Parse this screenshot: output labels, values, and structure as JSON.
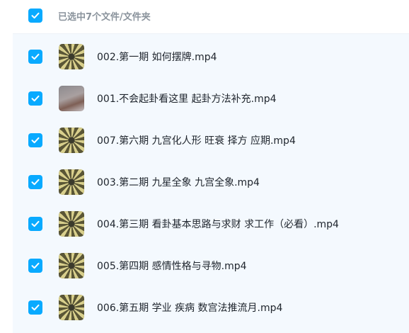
{
  "header": {
    "selection_label": "已选中7个文件/文件夹",
    "checked": true
  },
  "files": [
    {
      "name": "002.第一期 如何摆牌.mp4",
      "thumbnail": "bagua-thumbnail",
      "checked": true
    },
    {
      "name": "001.不会起卦看这里 起卦方法补充.mp4",
      "thumbnail": "photo-thumbnail",
      "checked": true
    },
    {
      "name": "007.第六期 九宫化人形 旺衰 择方 应期.mp4",
      "thumbnail": "bagua-thumbnail",
      "checked": true
    },
    {
      "name": "003.第二期 九星全象 九宫全象.mp4",
      "thumbnail": "bagua-thumbnail",
      "checked": true
    },
    {
      "name": "004.第三期 看卦基本思路与求财 求工作（必看）.mp4",
      "thumbnail": "bagua-thumbnail",
      "checked": true
    },
    {
      "name": "005.第四期 感情性格与寻物.mp4",
      "thumbnail": "bagua-thumbnail",
      "checked": true
    },
    {
      "name": "006.第五期 学业 疾病 数宫法推流月.mp4",
      "thumbnail": "bagua-thumbnail",
      "checked": true
    }
  ],
  "colors": {
    "checkbox": "#09aaff",
    "list_background": "#f4f9fe",
    "header_text": "#8a939c",
    "file_text": "#20262e"
  }
}
